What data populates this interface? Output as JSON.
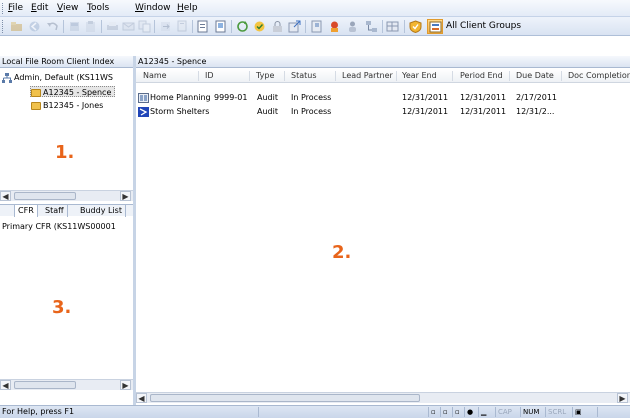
{
  "menu": {
    "file": {
      "u": "F",
      "rest": "ile"
    },
    "edit": {
      "u": "E",
      "rest": "dit"
    },
    "view": {
      "u": "V",
      "rest": "iew"
    },
    "tools": {
      "u": "T",
      "rest": "ools"
    },
    "window": {
      "u": "W",
      "rest": "indow"
    },
    "help": {
      "u": "H",
      "rest": "elp"
    }
  },
  "toolbar": {
    "client_groups_label": "All Client Groups",
    "buttons": [
      "open-icon",
      "back-icon",
      "undo-icon",
      "cut-icon",
      "paste-icon",
      "print-icon",
      "email-icon",
      "copy-icon",
      "move-icon",
      "find-icon",
      "new-document-icon",
      "properties-icon",
      "sync-icon",
      "checkout-icon",
      "lock-icon",
      "export-icon",
      "binder-icon",
      "users-icon",
      "people-icon",
      "network-icon",
      "grid-icon",
      "shield-icon",
      "client-groups-icon"
    ]
  },
  "client_index": {
    "title": "Local File Room Client Index",
    "root": "Admin, Default (KS11WS",
    "clients": [
      {
        "label": "A12345 - Spence",
        "selected": true
      },
      {
        "label": "B12345 - Jones",
        "selected": false
      }
    ]
  },
  "bottom_panel": {
    "tabs": [
      "CFR",
      "Staff",
      "Buddy List"
    ],
    "active_tab": "CFR",
    "item": "Primary CFR (KS11WS00001"
  },
  "main": {
    "title": "A12345 - Spence",
    "columns": [
      "Name",
      "ID",
      "Type",
      "Status",
      "Lead Partner",
      "Year End",
      "Period End",
      "Due Date",
      "Doc Completion"
    ],
    "rows": [
      {
        "icon": "binder-icon",
        "name": "Home Planning",
        "id": "9999-01",
        "type": "Audit",
        "status": "In Process",
        "lead_partner": "",
        "year_end": "12/31/2011",
        "period_end": "12/31/2011",
        "due_date": "2/17/2011"
      },
      {
        "icon": "storm-icon",
        "name": "Storm Shelters",
        "id": "",
        "type": "Audit",
        "status": "In Process",
        "lead_partner": "",
        "year_end": "12/31/2011",
        "period_end": "12/31/2011",
        "due_date": "12/31/2..."
      }
    ]
  },
  "annotations": {
    "one": "1.",
    "two": "2.",
    "three": "3."
  },
  "status": {
    "help_text": "For Help, press F1",
    "cap": "CAP",
    "num": "NUM",
    "scrl": "SCRL"
  }
}
